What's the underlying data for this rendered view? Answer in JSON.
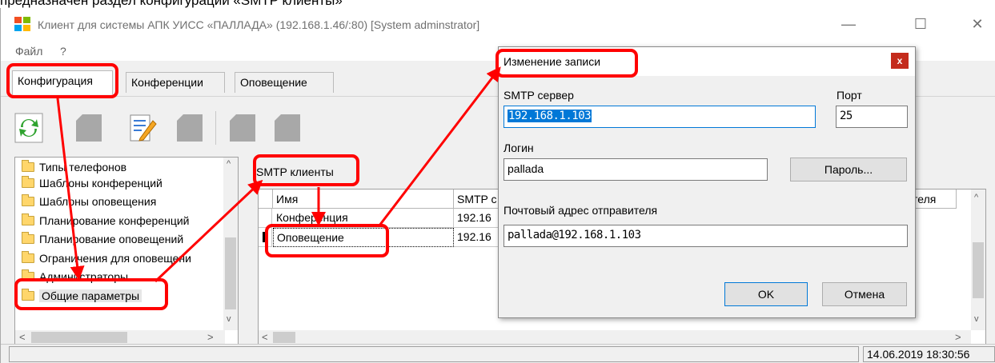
{
  "caption": "предназначен раздел конфигурации «SMTP клиенты»",
  "window": {
    "title": "Клиент для системы АПК УИСС «ПАЛЛАДА» (192.168.1.46/:80) [System adminstrator]",
    "controls": {
      "minimize": "—",
      "maximize": "☐",
      "close": "✕"
    }
  },
  "menu": {
    "items": [
      "Файл",
      "?"
    ]
  },
  "tabs": [
    {
      "label": "Конфигурация",
      "active": true
    },
    {
      "label": "Конференции",
      "active": false
    },
    {
      "label": "Оповещение",
      "active": false
    }
  ],
  "toolbar": {
    "buttons": [
      "refresh-icon",
      "add-icon",
      "edit-icon",
      "delete-icon",
      "up-icon",
      "down-icon"
    ]
  },
  "tree": {
    "items": [
      {
        "label": "Типы телефонов"
      },
      {
        "label": "Шаблоны конференций"
      },
      {
        "label": "Шаблоны оповещения"
      },
      {
        "label": "Планирование конференций"
      },
      {
        "label": "Планирование оповещений"
      },
      {
        "label": "Ограничения для оповещени"
      },
      {
        "label": "Администраторы"
      },
      {
        "label": "Общие параметры",
        "selected": true
      }
    ]
  },
  "panel": {
    "title": "SMTP клиенты",
    "columns": [
      "Имя",
      "SMTP с",
      "теля"
    ],
    "rows": [
      {
        "name": "Конференция",
        "smtp": "192.16"
      },
      {
        "name": "Оповещение",
        "smtp": "192.16",
        "current": true
      }
    ]
  },
  "status": {
    "datetime": "14.06.2019 18:30:56"
  },
  "dialog": {
    "title": "Изменение записи",
    "close": "x",
    "smtp_label": "SMTP сервер",
    "smtp_value": "192.168.1.103",
    "port_label": "Порт",
    "port_value": "25",
    "login_label": "Логин",
    "login_value": "pallada",
    "password_button": "Пароль...",
    "sender_label": "Почтовый адрес отправителя",
    "sender_value": "pallada@192.168.1.103",
    "ok": "OK",
    "cancel": "Отмена"
  },
  "colors": {
    "annotation": "#ff0000",
    "selection": "#0078d7",
    "dialog_close": "#c42b1c"
  }
}
